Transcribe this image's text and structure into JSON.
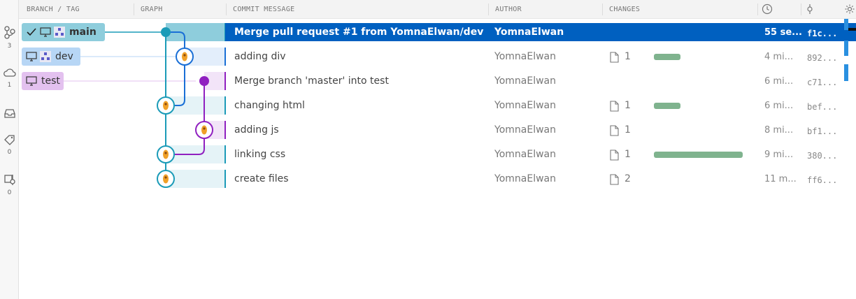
{
  "sidebar": {
    "branches_count": "3",
    "remotes_count": "1",
    "tags_count": "0",
    "worktrees_count": "0"
  },
  "columns": {
    "branch_tag": "BRANCH / TAG",
    "graph": "GRAPH",
    "message": "COMMIT MESSAGE",
    "author": "AUTHOR",
    "changes": "CHANGES"
  },
  "refs": {
    "main": "main",
    "dev": "dev",
    "test": "test"
  },
  "commits": [
    {
      "message": "Merge pull request #1 from YomnaElwan/dev",
      "author": "YomnaElwan",
      "files": "",
      "time": "55 se...",
      "sha": "f1c..."
    },
    {
      "message": "adding div",
      "author": "YomnaElwan",
      "files": "1",
      "time": "4 mi...",
      "sha": "892..."
    },
    {
      "message": "Merge branch 'master' into test",
      "author": "YomnaElwan",
      "files": "",
      "time": "6 mi...",
      "sha": "c71..."
    },
    {
      "message": "changing html",
      "author": "YomnaElwan",
      "files": "1",
      "time": "6 mi...",
      "sha": "bef..."
    },
    {
      "message": "adding js",
      "author": "YomnaElwan",
      "files": "1",
      "time": "8 mi...",
      "sha": "bf1..."
    },
    {
      "message": "linking css",
      "author": "YomnaElwan",
      "files": "1",
      "time": "9 mi...",
      "sha": "380..."
    },
    {
      "message": "create files",
      "author": "YomnaElwan",
      "files": "2",
      "time": "11 m...",
      "sha": "ff6..."
    }
  ],
  "colors": {
    "main": "#1b9bb8",
    "dev": "#1a6fd6",
    "test": "#9020c0",
    "selected": "#0060c0",
    "changes_bar": "#7fb38e"
  }
}
